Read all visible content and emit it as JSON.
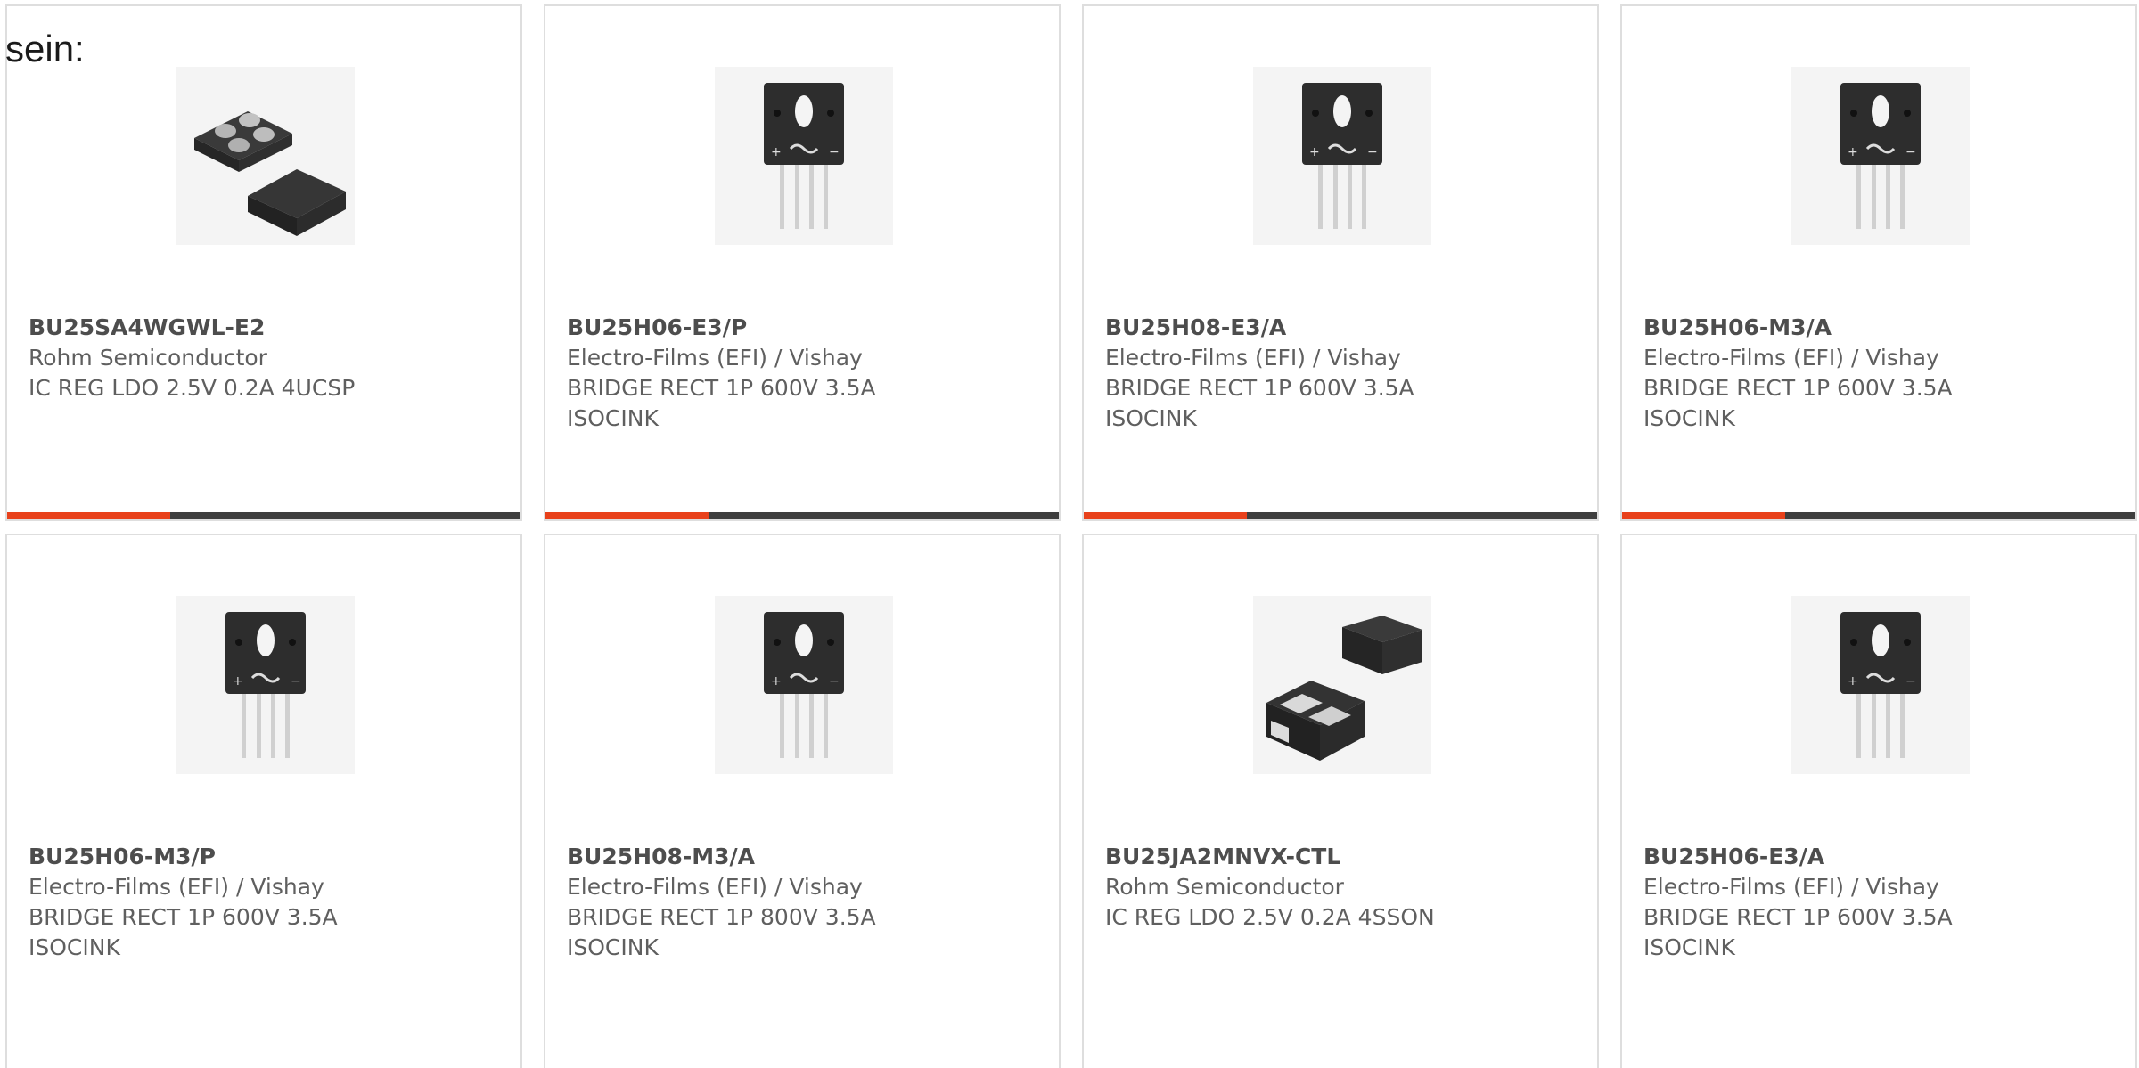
{
  "intro_text": "sein:",
  "colors": {
    "accent": "#e8411b",
    "bar": "#3e3e3e",
    "card_border": "#dedede"
  },
  "products": [
    {
      "part_number": "BU25SA4WGWL-E2",
      "manufacturer": "Rohm Semiconductor",
      "desc1": "IC REG LDO 2.5V 0.2A 4UCSP",
      "desc2": "",
      "image_icon": "ucsp-package-image"
    },
    {
      "part_number": "BU25H06-E3/P",
      "manufacturer": "Electro-Films (EFI) / Vishay",
      "desc1": "BRIDGE RECT 1P 600V 3.5A",
      "desc2": "ISOCINK",
      "image_icon": "bridge-rectifier-image"
    },
    {
      "part_number": "BU25H08-E3/A",
      "manufacturer": "Electro-Films (EFI) / Vishay",
      "desc1": "BRIDGE RECT 1P 600V 3.5A",
      "desc2": "ISOCINK",
      "image_icon": "bridge-rectifier-image"
    },
    {
      "part_number": "BU25H06-M3/A",
      "manufacturer": "Electro-Films (EFI) / Vishay",
      "desc1": "BRIDGE RECT 1P 600V 3.5A",
      "desc2": "ISOCINK",
      "image_icon": "bridge-rectifier-image"
    },
    {
      "part_number": "BU25H06-M3/P",
      "manufacturer": "Electro-Films (EFI) / Vishay",
      "desc1": "BRIDGE RECT 1P 600V 3.5A",
      "desc2": "ISOCINK",
      "image_icon": "bridge-rectifier-image"
    },
    {
      "part_number": "BU25H08-M3/A",
      "manufacturer": "Electro-Films (EFI) / Vishay",
      "desc1": "BRIDGE RECT 1P 800V 3.5A",
      "desc2": "ISOCINK",
      "image_icon": "bridge-rectifier-image"
    },
    {
      "part_number": "BU25JA2MNVX-CTL",
      "manufacturer": "Rohm Semiconductor",
      "desc1": "IC REG LDO 2.5V 0.2A 4SSON",
      "desc2": "",
      "image_icon": "sson-package-image"
    },
    {
      "part_number": "BU25H06-E3/A",
      "manufacturer": "Electro-Films (EFI) / Vishay",
      "desc1": "BRIDGE RECT 1P 600V 3.5A",
      "desc2": "ISOCINK",
      "image_icon": "bridge-rectifier-image"
    }
  ]
}
